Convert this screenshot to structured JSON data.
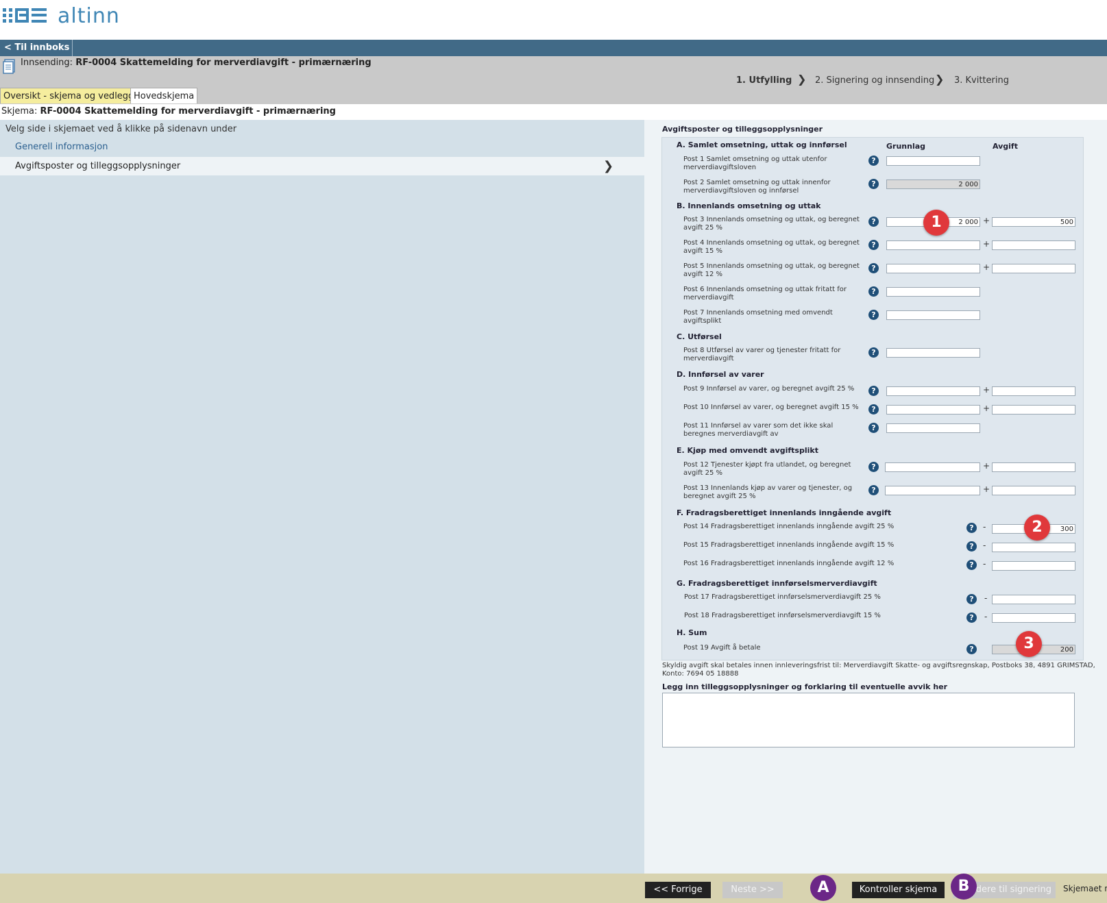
{
  "header": {
    "logo_text": "altinn",
    "back_label": "< Til innboks",
    "innsending_label": "Innsending:",
    "innsending_title": "RF-0004 Skattemelding for merverdiavgift - primærnæring",
    "steps": [
      {
        "label": "1. Utfylling",
        "active": true
      },
      {
        "label": "2. Signering og innsending",
        "active": false
      },
      {
        "label": "3. Kvittering",
        "active": false
      }
    ],
    "tabs": [
      {
        "label": "Oversikt - skjema og vedlegg",
        "selected": false
      },
      {
        "label": "Hovedskjema",
        "selected": true
      }
    ],
    "skjema_label": "Skjema:",
    "skjema_title": "RF-0004 Skattemelding for merverdiavgift - primærnæring"
  },
  "sidebar": {
    "hint": "Velg side i skjemaet ved å klikke på sidenavn under",
    "items": [
      {
        "label": "Generell informasjon"
      },
      {
        "label": "Avgiftsposter og tilleggsopplysninger",
        "selected": true
      }
    ]
  },
  "form": {
    "title": "Avgiftsposter og tilleggsopplysninger",
    "col_grunnlag": "Grunnlag",
    "col_avgift": "Avgift",
    "sections": {
      "a": "A. Samlet omsetning, uttak og innførsel",
      "b": "B. Innenlands omsetning og uttak",
      "c": "C. Utførsel",
      "d": "D. Innførsel av varer",
      "e": "E. Kjøp med omvendt avgiftsplikt",
      "f": "F. Fradragsberettiget innenlands inngående avgift",
      "g": "G. Fradragsberettiget innførselsmerverdiavgift",
      "h": "H. Sum"
    },
    "posts": {
      "p1": {
        "label": "Post 1 Samlet omsetning og uttak utenfor merverdiavgiftsloven",
        "grunnlag": ""
      },
      "p2": {
        "label": "Post 2 Samlet omsetning og uttak innenfor merverdiavgiftsloven og innførsel",
        "grunnlag": "2 000"
      },
      "p3": {
        "label": "Post 3 Innenlands omsetning og uttak, og beregnet avgift 25 %",
        "grunnlag": "2 000",
        "avgift": "500"
      },
      "p4": {
        "label": "Post 4 Innenlands omsetning og uttak, og beregnet avgift 15 %",
        "grunnlag": "",
        "avgift": ""
      },
      "p5": {
        "label": "Post 5 Innenlands omsetning og uttak, og beregnet avgift 12 %",
        "grunnlag": "",
        "avgift": ""
      },
      "p6": {
        "label": "Post 6 Innenlands omsetning og uttak fritatt for merverdiavgift",
        "grunnlag": ""
      },
      "p7": {
        "label": "Post 7 Innenlands omsetning med omvendt avgiftsplikt",
        "grunnlag": ""
      },
      "p8": {
        "label": "Post 8 Utførsel av varer og tjenester fritatt for merverdiavgift",
        "grunnlag": ""
      },
      "p9": {
        "label": "Post 9 Innførsel av varer, og beregnet avgift 25 %",
        "grunnlag": "",
        "avgift": ""
      },
      "p10": {
        "label": "Post 10 Innførsel av varer, og beregnet avgift 15 %",
        "grunnlag": "",
        "avgift": ""
      },
      "p11": {
        "label": "Post 11 Innførsel av varer som det ikke skal beregnes merverdiavgift av",
        "grunnlag": ""
      },
      "p12": {
        "label": "Post 12 Tjenester kjøpt fra utlandet, og beregnet avgift 25 %",
        "grunnlag": "",
        "avgift": ""
      },
      "p13": {
        "label": "Post 13 Innenlands kjøp av varer og tjenester, og beregnet avgift 25 %",
        "grunnlag": "",
        "avgift": ""
      },
      "p14": {
        "label": "Post 14 Fradragsberettiget innenlands inngående avgift 25 %",
        "avgift": "300"
      },
      "p15": {
        "label": "Post 15 Fradragsberettiget innenlands inngående avgift 15 %",
        "avgift": ""
      },
      "p16": {
        "label": "Post 16 Fradragsberettiget innenlands inngående avgift 12 %",
        "avgift": ""
      },
      "p17": {
        "label": "Post 17 Fradragsberettiget innførselsmerverdiavgift 25 %",
        "avgift": ""
      },
      "p18": {
        "label": "Post 18 Fradragsberettiget innførselsmerverdiavgift 15 %",
        "avgift": ""
      },
      "p19": {
        "label": "Post 19 Avgift å betale",
        "avgift": "200"
      }
    },
    "help_glyph": "?",
    "plus": "+",
    "minus": "-",
    "payment_note": "Skyldig avgift skal betales innen innleveringsfrist til: Merverdiavgift Skatte- og avgiftsregnskap, Postboks 38, 4891 GRIMSTAD, Konto: 7694 05 18888",
    "extra_info_label": "Legg inn tilleggsopplysninger og forklaring til eventuelle avvik her",
    "extra_info_value": ""
  },
  "markers": {
    "m1": "1",
    "m2": "2",
    "m3": "3",
    "a": "A",
    "b": "B"
  },
  "footer": {
    "prev": "<< Forrige",
    "next": "Neste >>",
    "check": "Kontroller skjema",
    "sign": "dere til signering",
    "status": "Skjemaet n"
  },
  "colors": {
    "topbar": "#416a87",
    "marker_red": "#e0383b",
    "marker_purple": "#6b2787",
    "link": "#2a5f8f"
  }
}
